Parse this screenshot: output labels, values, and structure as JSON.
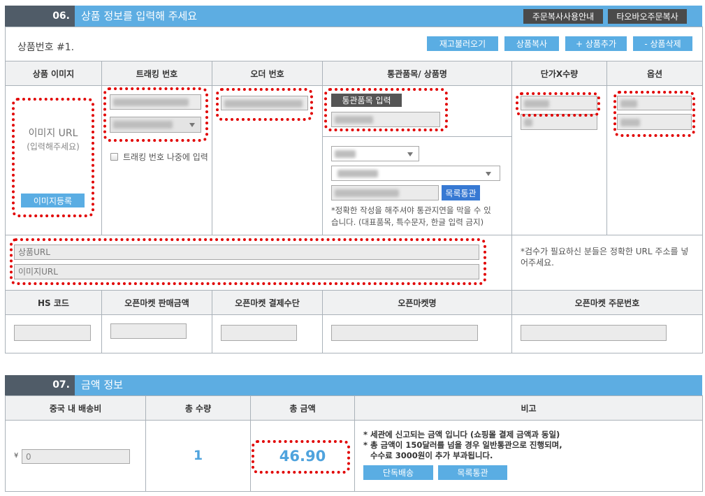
{
  "colors": {
    "section_header": "#5dade2",
    "section_number_bg": "#505c68",
    "dark_button": "#4a4a4a",
    "light_button": "#5aade3",
    "strong_button": "#3779d3",
    "header_cell_bg": "#f0f1f2",
    "value_text": "#4fa3dd",
    "annotation": "#e10000"
  },
  "section06": {
    "number": "06.",
    "title": "상품 정보를 입력해 주세요",
    "header_buttons": {
      "copy_guide": "주문복사사용안내",
      "taobao_copy": "타오바오주문복사"
    },
    "product_label": "상품번호 #1.",
    "actions": {
      "load_stock": "재고불러오기",
      "copy": "상품복사",
      "add": "+ 상품추가",
      "delete": "- 상품삭제"
    },
    "columns": [
      "상품 이미지",
      "트래킹 번호",
      "오더 번호",
      "통관품목/ 상품명",
      "단가X수량",
      "옵션"
    ],
    "image": {
      "title": "이미지 URL",
      "hint": "(입력해주세요)",
      "upload_button": "이미지등록"
    },
    "tracking": {
      "later_label": "트래킹 번호 나중에 입력",
      "later_checked": false
    },
    "customs": {
      "input_button": "통관품목 입력",
      "list_button": "목록통관",
      "note_lines": [
        "*정확한 작성을 해주셔야 통관지연을 막을 수 있",
        "습니다. (대표품목, 특수문자, 한글 입력 금지)"
      ]
    },
    "urls": {
      "product_placeholder": "상품URL",
      "image_placeholder": "이미지URL",
      "note_lines": [
        "*검수가 필요하신 분들은 정확한 URL 주소를 넣",
        "어주세요."
      ]
    },
    "columns2": [
      "HS 코드",
      "오픈마켓 판매금액",
      "오픈마켓 결제수단",
      "오픈마켓명",
      "오픈마켓 주문번호"
    ]
  },
  "section07": {
    "number": "07.",
    "title": "금액 정보",
    "columns": [
      "중국 내 배송비",
      "총 수량",
      "총 금액",
      "비고"
    ],
    "shipping": {
      "currency": "¥",
      "value": "0"
    },
    "total_quantity": "1",
    "total_amount": "46.90",
    "notes": [
      "* 세관에 신고되는 금액 입니다 (쇼핑몰 결제 금액과 동일)",
      "* 총 금액이 150달러를 넘을 경우 일반통관으로 진행되며,",
      "수수료 3000원이 추가 부과됩니다."
    ],
    "buttons": {
      "separate_shipping": "단독배송",
      "list_clearance": "목록통관"
    }
  }
}
